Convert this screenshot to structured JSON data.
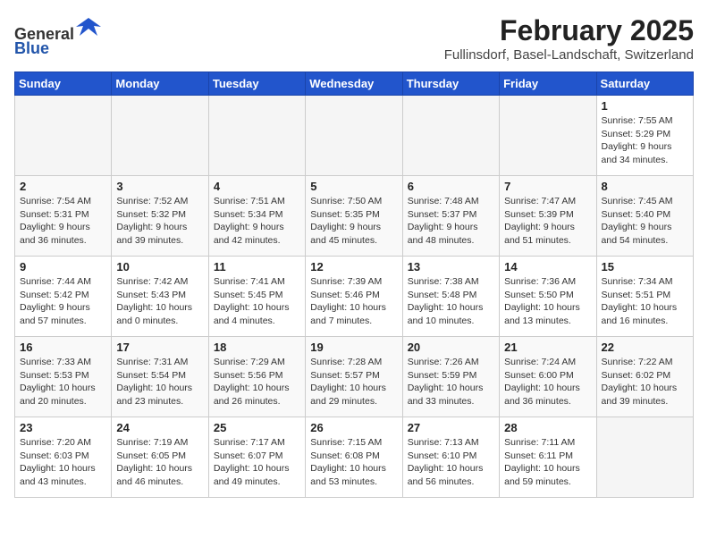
{
  "header": {
    "logo_general": "General",
    "logo_blue": "Blue",
    "month_year": "February 2025",
    "location": "Fullinsdorf, Basel-Landschaft, Switzerland"
  },
  "weekdays": [
    "Sunday",
    "Monday",
    "Tuesday",
    "Wednesday",
    "Thursday",
    "Friday",
    "Saturday"
  ],
  "weeks": [
    [
      {
        "day": "",
        "info": ""
      },
      {
        "day": "",
        "info": ""
      },
      {
        "day": "",
        "info": ""
      },
      {
        "day": "",
        "info": ""
      },
      {
        "day": "",
        "info": ""
      },
      {
        "day": "",
        "info": ""
      },
      {
        "day": "1",
        "info": "Sunrise: 7:55 AM\nSunset: 5:29 PM\nDaylight: 9 hours and 34 minutes."
      }
    ],
    [
      {
        "day": "2",
        "info": "Sunrise: 7:54 AM\nSunset: 5:31 PM\nDaylight: 9 hours and 36 minutes."
      },
      {
        "day": "3",
        "info": "Sunrise: 7:52 AM\nSunset: 5:32 PM\nDaylight: 9 hours and 39 minutes."
      },
      {
        "day": "4",
        "info": "Sunrise: 7:51 AM\nSunset: 5:34 PM\nDaylight: 9 hours and 42 minutes."
      },
      {
        "day": "5",
        "info": "Sunrise: 7:50 AM\nSunset: 5:35 PM\nDaylight: 9 hours and 45 minutes."
      },
      {
        "day": "6",
        "info": "Sunrise: 7:48 AM\nSunset: 5:37 PM\nDaylight: 9 hours and 48 minutes."
      },
      {
        "day": "7",
        "info": "Sunrise: 7:47 AM\nSunset: 5:39 PM\nDaylight: 9 hours and 51 minutes."
      },
      {
        "day": "8",
        "info": "Sunrise: 7:45 AM\nSunset: 5:40 PM\nDaylight: 9 hours and 54 minutes."
      }
    ],
    [
      {
        "day": "9",
        "info": "Sunrise: 7:44 AM\nSunset: 5:42 PM\nDaylight: 9 hours and 57 minutes."
      },
      {
        "day": "10",
        "info": "Sunrise: 7:42 AM\nSunset: 5:43 PM\nDaylight: 10 hours and 0 minutes."
      },
      {
        "day": "11",
        "info": "Sunrise: 7:41 AM\nSunset: 5:45 PM\nDaylight: 10 hours and 4 minutes."
      },
      {
        "day": "12",
        "info": "Sunrise: 7:39 AM\nSunset: 5:46 PM\nDaylight: 10 hours and 7 minutes."
      },
      {
        "day": "13",
        "info": "Sunrise: 7:38 AM\nSunset: 5:48 PM\nDaylight: 10 hours and 10 minutes."
      },
      {
        "day": "14",
        "info": "Sunrise: 7:36 AM\nSunset: 5:50 PM\nDaylight: 10 hours and 13 minutes."
      },
      {
        "day": "15",
        "info": "Sunrise: 7:34 AM\nSunset: 5:51 PM\nDaylight: 10 hours and 16 minutes."
      }
    ],
    [
      {
        "day": "16",
        "info": "Sunrise: 7:33 AM\nSunset: 5:53 PM\nDaylight: 10 hours and 20 minutes."
      },
      {
        "day": "17",
        "info": "Sunrise: 7:31 AM\nSunset: 5:54 PM\nDaylight: 10 hours and 23 minutes."
      },
      {
        "day": "18",
        "info": "Sunrise: 7:29 AM\nSunset: 5:56 PM\nDaylight: 10 hours and 26 minutes."
      },
      {
        "day": "19",
        "info": "Sunrise: 7:28 AM\nSunset: 5:57 PM\nDaylight: 10 hours and 29 minutes."
      },
      {
        "day": "20",
        "info": "Sunrise: 7:26 AM\nSunset: 5:59 PM\nDaylight: 10 hours and 33 minutes."
      },
      {
        "day": "21",
        "info": "Sunrise: 7:24 AM\nSunset: 6:00 PM\nDaylight: 10 hours and 36 minutes."
      },
      {
        "day": "22",
        "info": "Sunrise: 7:22 AM\nSunset: 6:02 PM\nDaylight: 10 hours and 39 minutes."
      }
    ],
    [
      {
        "day": "23",
        "info": "Sunrise: 7:20 AM\nSunset: 6:03 PM\nDaylight: 10 hours and 43 minutes."
      },
      {
        "day": "24",
        "info": "Sunrise: 7:19 AM\nSunset: 6:05 PM\nDaylight: 10 hours and 46 minutes."
      },
      {
        "day": "25",
        "info": "Sunrise: 7:17 AM\nSunset: 6:07 PM\nDaylight: 10 hours and 49 minutes."
      },
      {
        "day": "26",
        "info": "Sunrise: 7:15 AM\nSunset: 6:08 PM\nDaylight: 10 hours and 53 minutes."
      },
      {
        "day": "27",
        "info": "Sunrise: 7:13 AM\nSunset: 6:10 PM\nDaylight: 10 hours and 56 minutes."
      },
      {
        "day": "28",
        "info": "Sunrise: 7:11 AM\nSunset: 6:11 PM\nDaylight: 10 hours and 59 minutes."
      },
      {
        "day": "",
        "info": ""
      }
    ]
  ]
}
